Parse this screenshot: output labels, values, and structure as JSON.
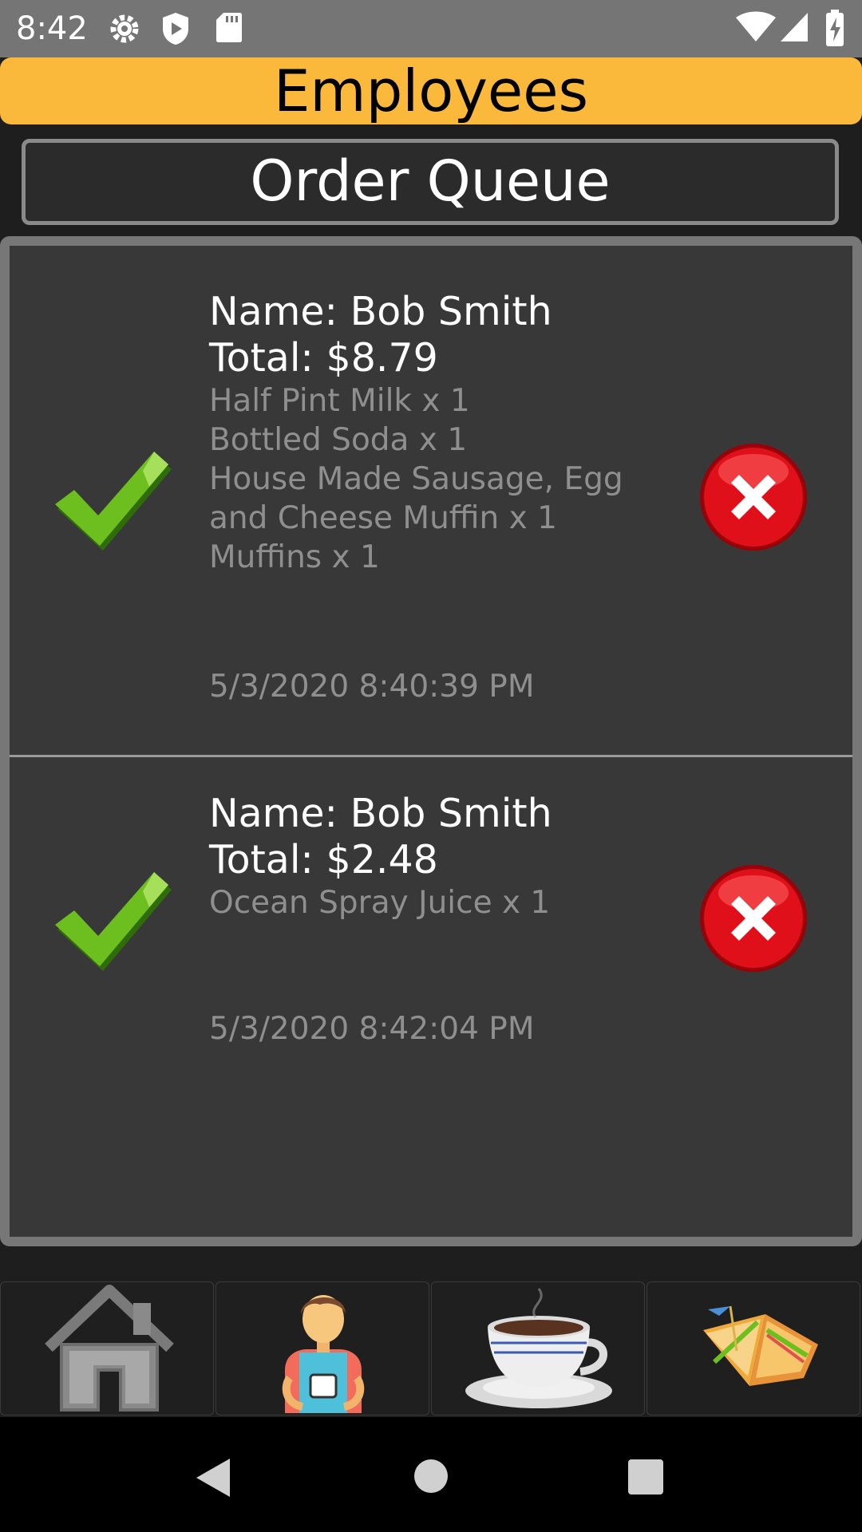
{
  "status_bar": {
    "time": "8:42"
  },
  "header": {
    "title": "Employees"
  },
  "queue": {
    "label": "Order Queue"
  },
  "orders": [
    {
      "name": "Name: Bob Smith",
      "total": "Total: $8.79",
      "items": [
        "Half Pint Milk x 1",
        "Bottled Soda x 1",
        "House Made Sausage, Egg",
        "and Cheese Muffin x 1",
        "Muffins x 1"
      ],
      "timestamp": "5/3/2020 8:40:39 PM"
    },
    {
      "name": "Name: Bob Smith",
      "total": "Total: $2.48",
      "items": [
        "Ocean Spray Juice x 1"
      ],
      "timestamp": "5/3/2020 8:42:04 PM"
    }
  ],
  "bottom_nav": [
    "home-icon",
    "employee-icon",
    "coffee-cup-icon",
    "sandwich-icon"
  ],
  "colors": {
    "header": "#fbb93b",
    "accept": "#6cbf1e",
    "reject": "#e0101a"
  }
}
